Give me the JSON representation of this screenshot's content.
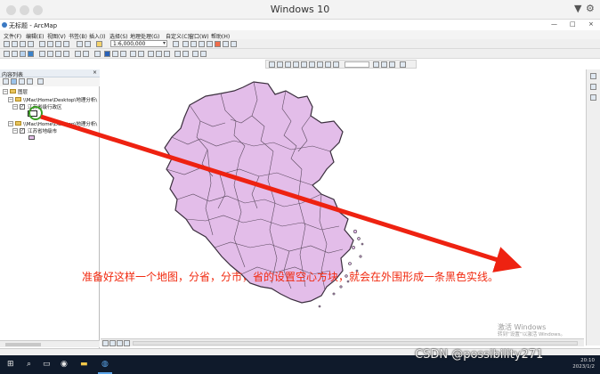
{
  "vm_window": {
    "title": "Windows 10"
  },
  "app": {
    "title": "无标题 - ArcMap",
    "menu": [
      "文件(F)",
      "编辑(E)",
      "视图(V)",
      "书签(B)",
      "插入(I)",
      "选择(S)",
      "地理处理(G)",
      "自定义(C)",
      "窗口(W)",
      "帮助(H)"
    ],
    "scale_value": "1:6,000,000"
  },
  "toc": {
    "title": "内容列表",
    "close_glyph": "× ",
    "root_label": "图层",
    "groups": [
      {
        "path": "\\\\Mac\\Home\\Desktop\\地理分析\\",
        "layer": "江苏省级行政区"
      },
      {
        "path": "\\\\Mac\\Home\\Desktop\\地理分析\\",
        "layer": "江苏省地级市"
      }
    ]
  },
  "annotation": {
    "caption": "准备好这样一个地图，分省，分市，省的设置空心方块，就会在外围形成一条黑色实线。",
    "arrow_color": "#ee2211",
    "highlight_color": "#3a9e23"
  },
  "activation": {
    "line1": "激活 Windows",
    "line2": "转到“设置”以激活 Windows。"
  },
  "watermark": "CSDN @possibility271",
  "taskbar": {
    "time": "20:10",
    "date": "2023/1/2"
  },
  "colors": {
    "polygon_fill": "#e3bde9",
    "polygon_stroke": "#5a4a5e"
  }
}
